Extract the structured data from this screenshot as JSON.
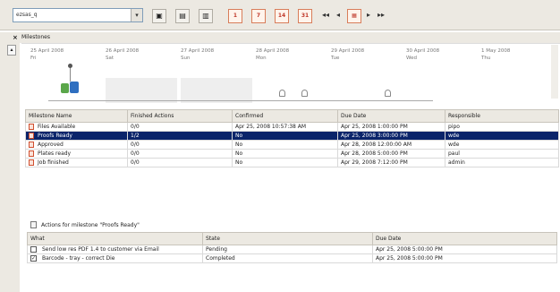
{
  "toolbar": {
    "combo_value": "ezsas_q",
    "buttons": [
      {
        "name": "new-milestone-icon",
        "glyph": "▣"
      },
      {
        "name": "delete-milestone-icon",
        "glyph": "▤"
      },
      {
        "name": "edit-milestone-icon",
        "glyph": "▥"
      },
      {
        "name": "calendar-1-button",
        "label": "1"
      },
      {
        "name": "calendar-7-button",
        "label": "7"
      },
      {
        "name": "calendar-14-button",
        "label": "14"
      },
      {
        "name": "calendar-31-button",
        "label": "31"
      }
    ]
  },
  "panel": {
    "close": "×",
    "title": "Milestones"
  },
  "timeline": {
    "days": [
      {
        "date": "25 April  2008",
        "dow": "Fri"
      },
      {
        "date": "26 April  2008",
        "dow": "Sat"
      },
      {
        "date": "27 April  2008",
        "dow": "Sun"
      },
      {
        "date": "28 April  2008",
        "dow": "Mon"
      },
      {
        "date": "29 April  2008",
        "dow": "Tue"
      },
      {
        "date": "30 April  2008",
        "dow": "Wed"
      },
      {
        "date": "1 May  2008",
        "dow": "Thu"
      }
    ]
  },
  "milestones": {
    "columns": [
      "Milestone Name",
      "Finished Actions",
      "Confirmed",
      "Due Date",
      "Responsible"
    ],
    "rows": [
      [
        "Files Available",
        "0/0",
        "Apr 25, 2008 10:57:38 AM",
        "Apr 25, 2008 1:00:00 PM",
        "pipo"
      ],
      [
        "Proofs Ready",
        "1/2",
        "No",
        "Apr 25, 2008 3:00:00 PM",
        "wde"
      ],
      [
        "Approved",
        "0/0",
        "No",
        "Apr 28, 2008 12:00:00 AM",
        "wde"
      ],
      [
        "Plates ready",
        "0/0",
        "No",
        "Apr 28, 2008 5:00:00 PM",
        "paul"
      ],
      [
        "Job finished",
        "0/0",
        "No",
        "Apr 29, 2008 7:12:00 PM",
        "admin"
      ]
    ]
  },
  "actions": {
    "title": "Actions for milestone \"Proofs Ready\"",
    "columns": [
      "What",
      "State",
      "Due Date"
    ],
    "rows": [
      [
        "Send low res PDF 1.4 to customer via Email",
        "Pending",
        "Apr 25, 2008 5:00:00 PM"
      ],
      [
        "Barcode - tray - correct Die",
        "Completed",
        "Apr 25, 2008 5:00:00 PM"
      ]
    ]
  }
}
